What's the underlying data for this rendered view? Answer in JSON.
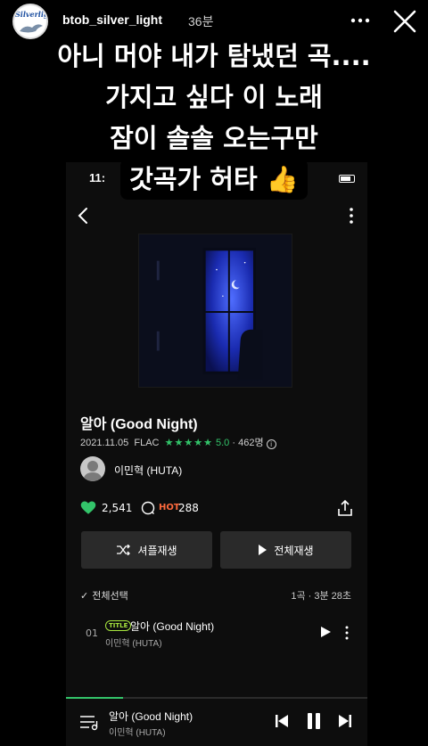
{
  "story": {
    "username": "btob_silver_light",
    "time_ago": "36분",
    "avatar_text": "Silverlight"
  },
  "overlay_text": {
    "lines": [
      "아니 머야 내가 탐냈던 곡....",
      "가지고 싶다 이 노래",
      "잠이 솔솔 오는구만",
      "갓곡가 허타 👍"
    ]
  },
  "phone": {
    "status_time": "11:",
    "song": {
      "title": "알아 (Good Night)",
      "release_date": "2021.11.05",
      "format": "FLAC",
      "stars": "★★★★★",
      "rating": "5.0",
      "rating_count": "462명",
      "artist": "이민혁 (HUTA)"
    },
    "stats": {
      "likes": "2,541",
      "hot_label": "HOT",
      "comments": "288"
    },
    "buttons": {
      "shuffle": "셔플재생",
      "play_all": "전체재생"
    },
    "tracklist": {
      "select_all": "전체선택",
      "summary": "1곡 · 3분 28초",
      "tracks": [
        {
          "number": "01",
          "badge": "TITLE",
          "title": "알아 (Good Night)",
          "artist": "이민혁 (HUTA)"
        }
      ]
    },
    "player": {
      "title": "알아 (Good Night)",
      "artist": "이민혁 (HUTA)",
      "progress": 0.19
    }
  },
  "colors": {
    "accent_green": "#33c46a",
    "hot_orange": "#ff6a3d",
    "title_badge": "#a8e63f"
  }
}
